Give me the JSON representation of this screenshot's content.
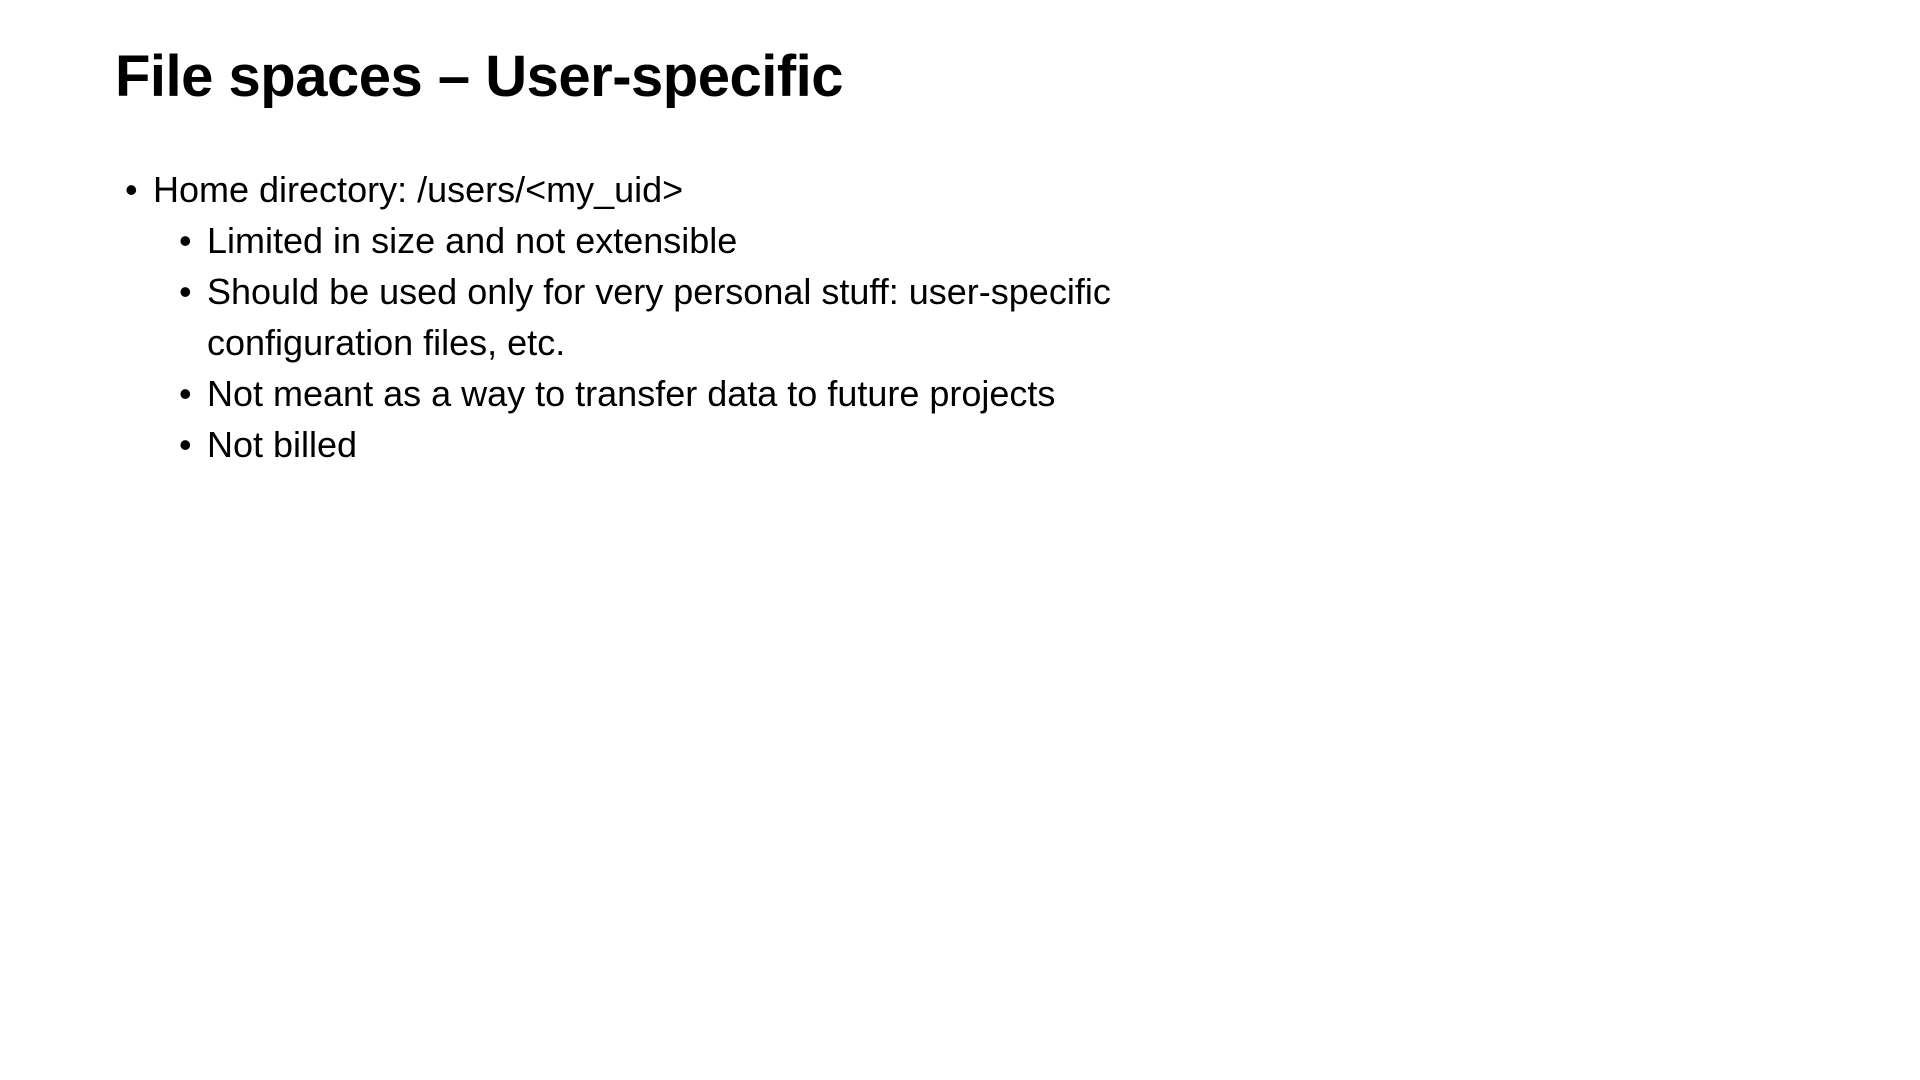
{
  "slide": {
    "title": "File spaces – User-specific",
    "bullets": {
      "main": "Home directory: /users/<my_uid>",
      "sub": [
        "Limited in size and not extensible",
        "Should be used only for very personal stuff: user-specific configuration files, etc.",
        "Not meant as a way to transfer data to future projects",
        "Not billed"
      ]
    }
  }
}
